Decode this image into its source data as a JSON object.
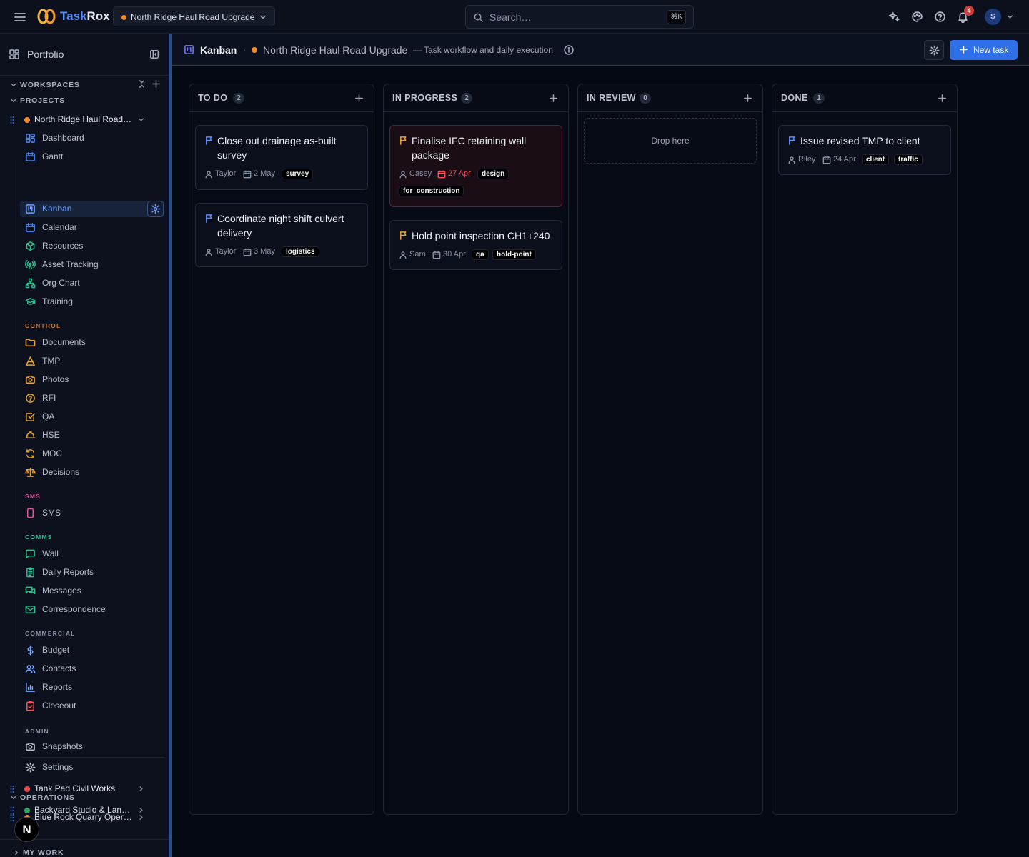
{
  "topbar": {
    "brand_a": "Task",
    "brand_b": "Rox",
    "project_picker": "North Ridge Haul Road Upgrade",
    "search_placeholder": "Search…",
    "search_shortcut": "⌘K",
    "notifications_count": "4",
    "avatar_initial": "S",
    "icons": [
      "menu-icon",
      "sparkles-icon",
      "palette-icon",
      "help-icon",
      "bell-icon"
    ]
  },
  "sidebar": {
    "header": "Portfolio",
    "workspaces_label": "WORKSPACES",
    "projects_label": "PROJECTS",
    "operations_label": "OPERATIONS",
    "mywork_label": "MY WORK",
    "active_project": "North Ridge Haul Road…",
    "items_main": [
      {
        "label": "Dashboard",
        "icon": "dashboard-icon"
      },
      {
        "label": "Gantt",
        "icon": "gantt-icon"
      },
      {
        "label": "Kanban",
        "icon": "kanban-icon"
      },
      {
        "label": "Calendar",
        "icon": "calendar-icon"
      },
      {
        "label": "Resources",
        "icon": "box-icon"
      },
      {
        "label": "Asset Tracking",
        "icon": "radio-tower-icon"
      },
      {
        "label": "Org Chart",
        "icon": "org-chart-icon"
      },
      {
        "label": "Training",
        "icon": "graduation-cap-icon"
      }
    ],
    "group_control": "CONTROL",
    "items_control": [
      {
        "label": "Documents",
        "icon": "folder-icon"
      },
      {
        "label": "TMP",
        "icon": "cone-icon"
      },
      {
        "label": "Photos",
        "icon": "camera-icon"
      },
      {
        "label": "RFI",
        "icon": "question-circle-icon"
      },
      {
        "label": "QA",
        "icon": "check-square-icon"
      },
      {
        "label": "HSE",
        "icon": "hard-hat-icon"
      },
      {
        "label": "MOC",
        "icon": "refresh-icon"
      },
      {
        "label": "Decisions",
        "icon": "scale-icon"
      }
    ],
    "group_sms": "SMS",
    "items_sms": [
      {
        "label": "SMS",
        "icon": "phone-icon"
      }
    ],
    "group_comms": "COMMS",
    "items_comms": [
      {
        "label": "Wall",
        "icon": "message-square-icon"
      },
      {
        "label": "Daily Reports",
        "icon": "clipboard-icon"
      },
      {
        "label": "Messages",
        "icon": "messages-icon"
      },
      {
        "label": "Correspondence",
        "icon": "mail-icon"
      }
    ],
    "group_commercial": "COMMERCIAL",
    "items_commercial": [
      {
        "label": "Budget",
        "icon": "dollar-icon"
      },
      {
        "label": "Contacts",
        "icon": "users-icon"
      },
      {
        "label": "Reports",
        "icon": "bar-chart-icon"
      },
      {
        "label": "Closeout",
        "icon": "clipboard-check-icon"
      }
    ],
    "group_admin": "ADMIN",
    "items_admin": [
      {
        "label": "Snapshots",
        "icon": "camera-icon"
      },
      {
        "label": "Settings",
        "icon": "gear-icon"
      }
    ],
    "other_projects": [
      {
        "label": "Tank Pad Civil Works",
        "color": "#e5484d"
      },
      {
        "label": "Backyard Studio & Lan…",
        "color": "#30a46c"
      }
    ],
    "operations_projects": [
      {
        "label": "Blue Rock Quarry Oper…",
        "color": "#f28b2c"
      }
    ],
    "fab_label": "N"
  },
  "header": {
    "view_title": "Kanban",
    "project_name": "North Ridge Haul Road Upgrade",
    "description": "— Task workflow and daily execution",
    "new_task_label": "New task"
  },
  "board": {
    "columns": [
      {
        "title": "TO DO",
        "count": "2",
        "cards": [
          {
            "title": "Close out drainage as-built survey",
            "assignee": "Taylor",
            "date": "2 May",
            "tags": [
              "survey"
            ]
          },
          {
            "title": "Coordinate night shift culvert delivery",
            "assignee": "Taylor",
            "date": "3 May",
            "tags": [
              "logistics"
            ]
          }
        ]
      },
      {
        "title": "IN PROGRESS",
        "count": "2",
        "cards": [
          {
            "title": "Finalise IFC retaining wall package",
            "assignee": "Casey",
            "date": "27 Apr",
            "overdue": true,
            "tags": [
              "design",
              "for_construction"
            ]
          },
          {
            "title": "Hold point inspection CH1+240",
            "assignee": "Sam",
            "date": "30 Apr",
            "tags": [
              "qa",
              "hold-point"
            ]
          }
        ]
      },
      {
        "title": "IN REVIEW",
        "count": "0",
        "drop_label": "Drop here",
        "cards": []
      },
      {
        "title": "DONE",
        "count": "1",
        "cards": [
          {
            "title": "Issue revised TMP to client",
            "assignee": "Riley",
            "date": "24 Apr",
            "tags": [
              "client",
              "traffic"
            ]
          }
        ]
      }
    ]
  },
  "colors": {
    "accent": "#2f6fe8",
    "project_orange": "#f28b2c",
    "overdue_red": "#f2555a",
    "group_control": "#c4793a",
    "group_sms": "#d85ba0",
    "group_comms": "#2fbf8f",
    "group_commercial": "#8a93a6",
    "group_admin": "#8a93a6"
  }
}
